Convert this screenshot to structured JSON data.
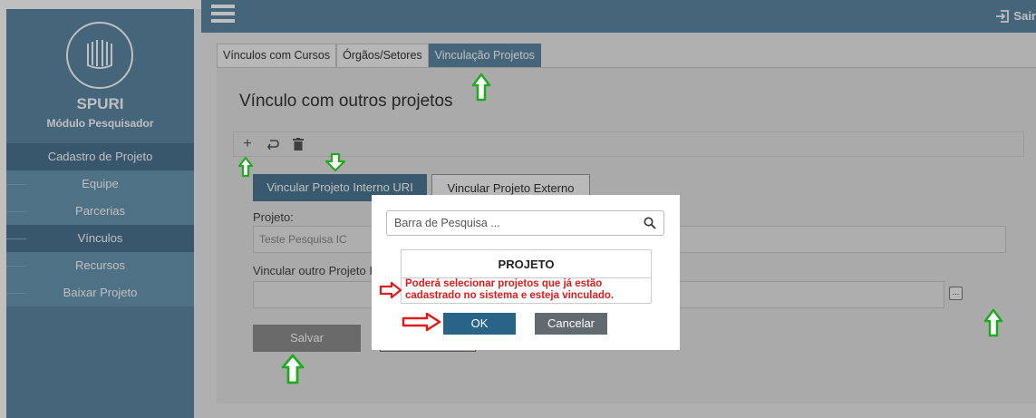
{
  "sidebar": {
    "brand": "SPURI",
    "module": "Módulo Pesquisador",
    "items": [
      {
        "label": "Cadastro de Projeto"
      },
      {
        "label": "Equipe"
      },
      {
        "label": "Parcerias"
      },
      {
        "label": "Vínculos"
      },
      {
        "label": "Recursos"
      },
      {
        "label": "Baixar Projeto"
      }
    ]
  },
  "topbar": {
    "exit_label": "Sair"
  },
  "tabs": [
    {
      "label": "Vínculos com Cursos"
    },
    {
      "label": "Órgãos/Setores"
    },
    {
      "label": "Vinculação Projetos"
    }
  ],
  "main": {
    "title": "Vínculo com outros projetos",
    "subtabs": {
      "interno": "Vincular Projeto Interno URI",
      "externo": "Vincular Projeto Externo"
    },
    "projeto_label": "Projeto:",
    "projeto_value": "Teste Pesquisa IC",
    "vincular_label": "Vincular outro Projeto I",
    "dots_label": "...",
    "salvar_label": "Salvar"
  },
  "modal": {
    "search_placeholder": "Barra de Pesquisa ...",
    "table_header": "PROJETO",
    "message": "Poderá selecionar projetos que já estão cadastrado no sistema e esteja vinculado.",
    "ok_label": "OK",
    "cancel_label": "Cancelar"
  },
  "colors": {
    "sidebar": "#5b87a3",
    "primary_button": "#276488",
    "annotation_green": "#1faa1f",
    "annotation_red": "#e01b1b"
  }
}
